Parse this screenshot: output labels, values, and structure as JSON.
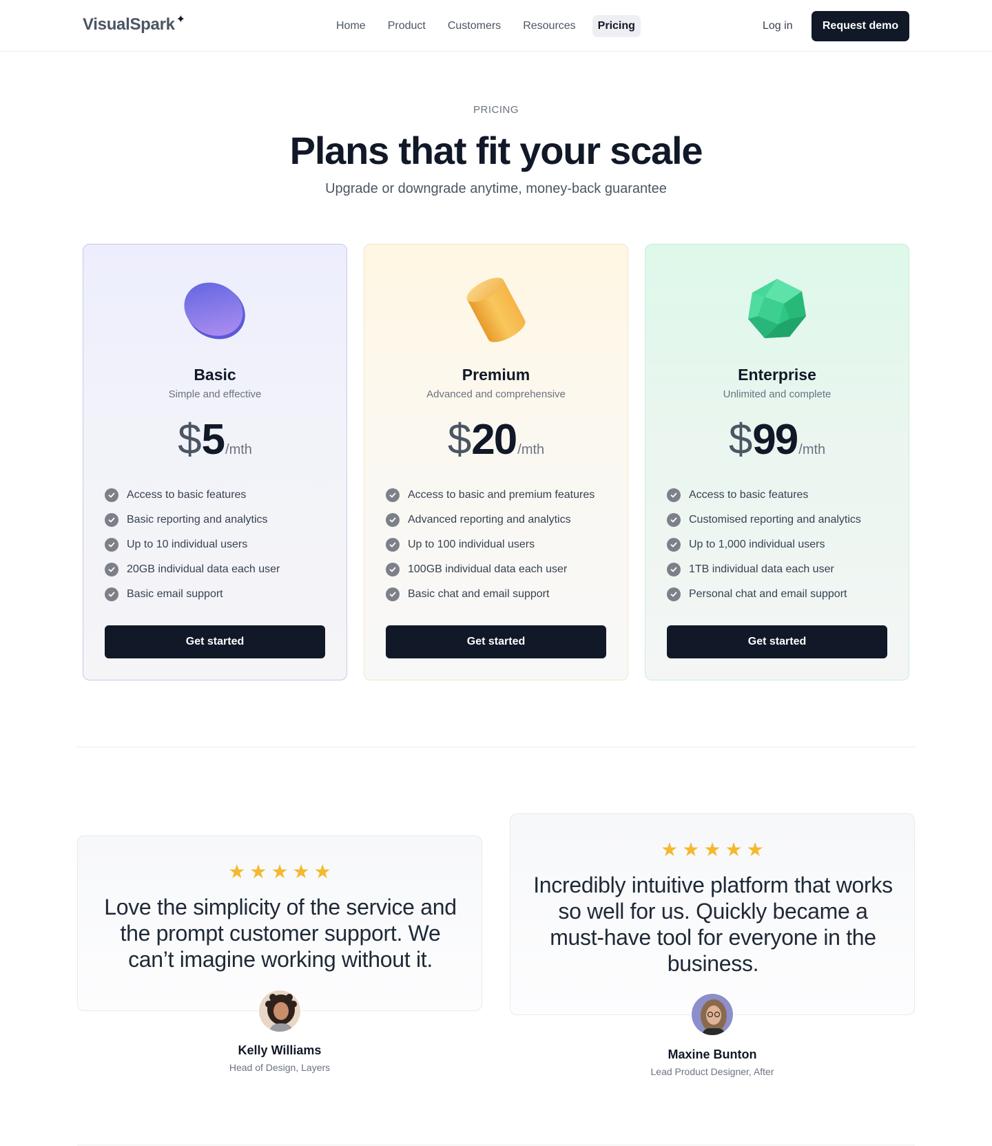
{
  "nav": {
    "logo": "VisualSpark",
    "links": [
      {
        "label": "Home"
      },
      {
        "label": "Product"
      },
      {
        "label": "Customers"
      },
      {
        "label": "Resources"
      },
      {
        "label": "Pricing",
        "active": true
      }
    ],
    "login": "Log in",
    "demo": "Request demo"
  },
  "hero": {
    "eyebrow": "PRICING",
    "title": "Plans that fit your scale",
    "subtitle": "Upgrade or downgrade anytime, money-back guarantee"
  },
  "plans": [
    {
      "name": "Basic",
      "tagline": "Simple and effective",
      "currency": "$",
      "price": "5",
      "period": "/mth",
      "icon": "disc-icon",
      "features": [
        "Access to basic features",
        "Basic reporting and analytics",
        "Up to 10 individual users",
        "20GB individual data each user",
        "Basic email support"
      ],
      "cta": "Get started"
    },
    {
      "name": "Premium",
      "tagline": "Advanced and comprehensive",
      "currency": "$",
      "price": "20",
      "period": "/mth",
      "icon": "cylinder-icon",
      "features": [
        "Access to basic and premium features",
        "Advanced reporting and analytics",
        "Up to 100 individual users",
        "100GB individual data each user",
        "Basic chat and email support"
      ],
      "cta": "Get started"
    },
    {
      "name": "Enterprise",
      "tagline": "Unlimited and complete",
      "currency": "$",
      "price": "99",
      "period": "/mth",
      "icon": "gem-icon",
      "features": [
        "Access to basic features",
        "Customised reporting and analytics",
        "Up to 1,000 individual users",
        "1TB individual data each user",
        "Personal chat and email support"
      ],
      "cta": "Get started"
    }
  ],
  "testimonials": [
    {
      "rating": 5,
      "quote": "Love the simplicity of the service and the prompt customer support. We can’t imagine working without it.",
      "name": "Kelly Williams",
      "role": "Head of Design, Layers"
    },
    {
      "rating": 5,
      "quote": "Incredibly intuitive platform that works so well for us. Quickly became a must-have tool for everyone in the business.",
      "name": "Maxine Bunton",
      "role": "Lead Product Designer, After"
    }
  ],
  "colors": {
    "primary": "#111827",
    "star": "#f5b82e",
    "basic_accent": "#7b7ff0",
    "premium_accent": "#f2b84b",
    "enterprise_accent": "#34d399"
  }
}
